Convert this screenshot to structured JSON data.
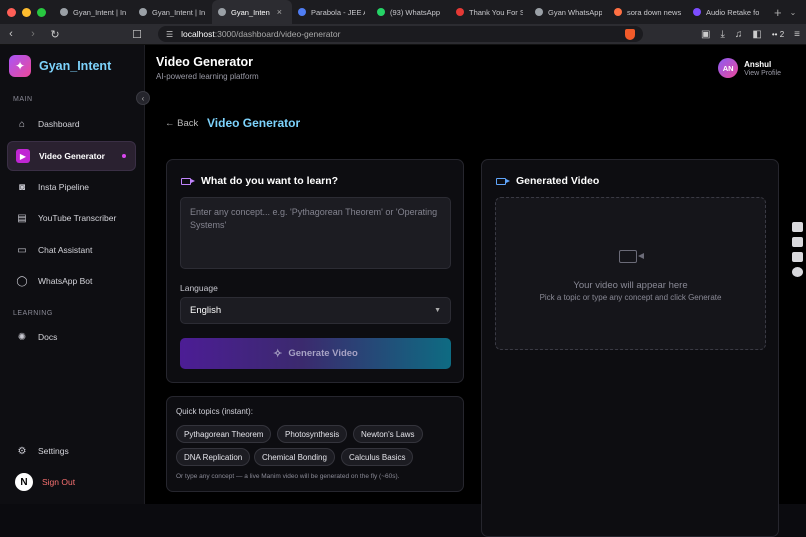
{
  "browser": {
    "tabs": [
      {
        "label": "Gyan_Intent | In",
        "fav": "#9aa0a6"
      },
      {
        "label": "Gyan_Intent | In",
        "fav": "#9aa0a6"
      },
      {
        "label": "Gyan_Inten",
        "fav": "#9aa0a6",
        "active": true
      },
      {
        "label": "Parabola - JEE A",
        "fav": "#4f7df3"
      },
      {
        "label": "(93) WhatsApp",
        "fav": "#25d366"
      },
      {
        "label": "Thank You For S",
        "fav": "#e53935"
      },
      {
        "label": "Gyan WhatsApp",
        "fav": "#9aa0a6"
      },
      {
        "label": "sora down news",
        "fav": "#ff7043"
      },
      {
        "label": "Audio Retake fo",
        "fav": "#7c4dff"
      }
    ],
    "close_glyph": "×",
    "new_tab_glyph": "+",
    "url_host": "localhost",
    "url_path": ":3000/dashboard/video-generator",
    "ext_count": "2"
  },
  "sidebar": {
    "brand": "Gyan_Intent",
    "section_main": "MAIN",
    "section_learning": "LEARNING",
    "items": [
      {
        "label": "Dashboard",
        "icon": "home-icon"
      },
      {
        "label": "Video Generator",
        "icon": "video-icon",
        "active": true
      },
      {
        "label": "Insta Pipeline",
        "icon": "instagram-icon"
      },
      {
        "label": "YouTube Transcriber",
        "icon": "document-icon"
      },
      {
        "label": "Chat Assistant",
        "icon": "chat-icon"
      },
      {
        "label": "WhatsApp Bot",
        "icon": "whatsapp-icon"
      }
    ],
    "learning_items": [
      {
        "label": "Docs",
        "icon": "settings-icon"
      }
    ],
    "settings": "Settings",
    "sign_out": "Sign Out",
    "footer_avatar": "N"
  },
  "header": {
    "title": "Video Generator",
    "subtitle": "AI-powered learning platform",
    "user_initials": "AN",
    "user_name": "Anshul",
    "user_link": "View Profile"
  },
  "page": {
    "back": "← Back",
    "title": "Video Generator"
  },
  "input_card": {
    "title": "What do you want to learn?",
    "placeholder": "Enter any concept... e.g. 'Pythagorean Theorem' or 'Operating Systems'",
    "language_label": "Language",
    "language_value": "English",
    "generate_label": "Generate Video"
  },
  "output_card": {
    "title": "Generated Video",
    "placeholder_main": "Your video will appear here",
    "placeholder_sub": "Pick a topic or type any concept and click Generate"
  },
  "quick_topics": {
    "label": "Quick topics (instant):",
    "chips": [
      "Pythagorean Theorem",
      "Photosynthesis",
      "Newton's Laws",
      "DNA Replication",
      "Chemical Bonding",
      "Calculus Basics"
    ],
    "note": "Or type any concept — a live Manim video will be generated on the fly (~60s)."
  },
  "colors": {
    "accent": "#7dd3fc",
    "active_nav": "#c026d3",
    "sign_out": "#f87171"
  }
}
